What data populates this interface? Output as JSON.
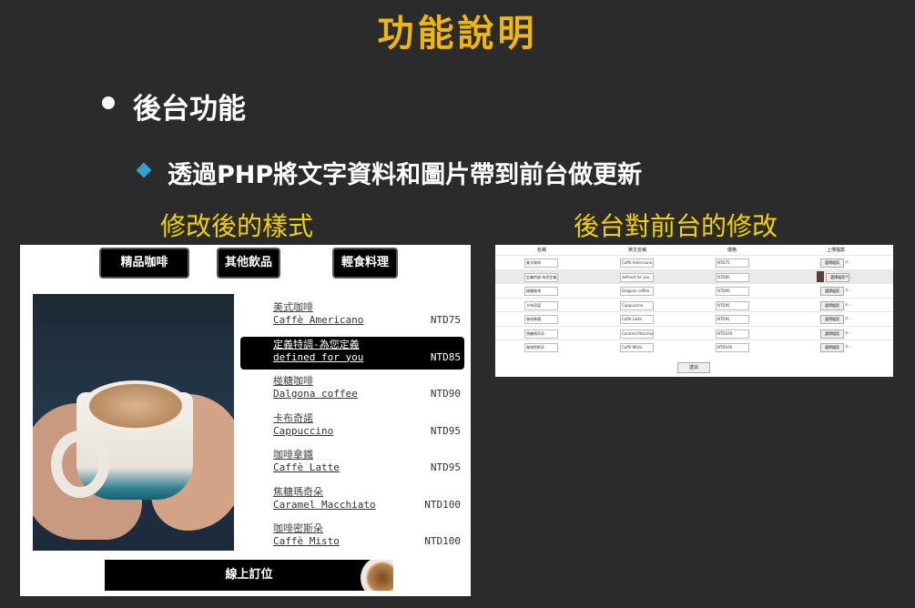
{
  "slide": {
    "title": "功能說明",
    "bullet": "後台功能",
    "sub_bullet": "透過PHP將文字資料和圖片帶到前台做更新",
    "caption_left": "修改後的樣式",
    "caption_right": "後台對前台的修改"
  },
  "colors": {
    "background": "#2b2b2b",
    "title": "#f2b705",
    "caption": "#f2d200",
    "diamond": "#2ea3c9"
  },
  "preview": {
    "categories": [
      "精品咖啡",
      "其他飲品",
      "輕食料理"
    ],
    "menu": [
      {
        "zh": "美式咖啡",
        "en": "Caffè Americano",
        "price": "NTD75",
        "selected": false
      },
      {
        "zh": "定義特調-為您定義",
        "en": "defined for you",
        "price": "NTD85",
        "selected": true
      },
      {
        "zh": "椪糖咖啡",
        "en": "Dalgona coffee",
        "price": "NTD90",
        "selected": false
      },
      {
        "zh": "卡布奇諾",
        "en": "Cappuccino",
        "price": "NTD95",
        "selected": false
      },
      {
        "zh": "咖啡拿鐵",
        "en": "Caffè Latte",
        "price": "NTD95",
        "selected": false
      },
      {
        "zh": "焦糖瑪奇朵",
        "en": "Caramel Macchiato",
        "price": "NTD100",
        "selected": false
      },
      {
        "zh": "咖啡密斯朵",
        "en": "Caffè Misto",
        "price": "NTD100",
        "selected": false
      }
    ],
    "order_button": "線上訂位"
  },
  "admin": {
    "headers": [
      "名稱",
      "英文名稱",
      "價格",
      "上傳檔案"
    ],
    "rows": [
      {
        "name": "美式咖啡",
        "en": "Caffè Americano",
        "price": "NTD75",
        "file_btn": "選擇檔案",
        "file_name": "未...",
        "highlight": false,
        "thumb": false
      },
      {
        "name": "定義特調-為您定義",
        "en": "defined for you",
        "price": "NTD85",
        "file_btn": "選擇檔案",
        "file_name": "未...",
        "highlight": true,
        "thumb": true
      },
      {
        "name": "椪糖咖啡",
        "en": "Dalgona coffee",
        "price": "NTD90",
        "file_btn": "選擇檔案",
        "file_name": "未...",
        "highlight": false,
        "thumb": false
      },
      {
        "name": "卡布奇諾",
        "en": "Cappuccino",
        "price": "NTD95",
        "file_btn": "選擇檔案",
        "file_name": "未...",
        "highlight": false,
        "thumb": false
      },
      {
        "name": "咖啡拿鐵",
        "en": "Caffè Latte",
        "price": "NTD95",
        "file_btn": "選擇檔案",
        "file_name": "未...",
        "highlight": false,
        "thumb": false
      },
      {
        "name": "焦糖瑪奇朵",
        "en": "Caramel Macchiato",
        "price": "NTD100",
        "file_btn": "選擇檔案",
        "file_name": "未...",
        "highlight": false,
        "thumb": false
      },
      {
        "name": "咖啡密斯朵",
        "en": "Caffè Misto",
        "price": "NTD100",
        "file_btn": "選擇檔案",
        "file_name": "未...",
        "highlight": false,
        "thumb": false
      }
    ],
    "submit": "送出"
  }
}
